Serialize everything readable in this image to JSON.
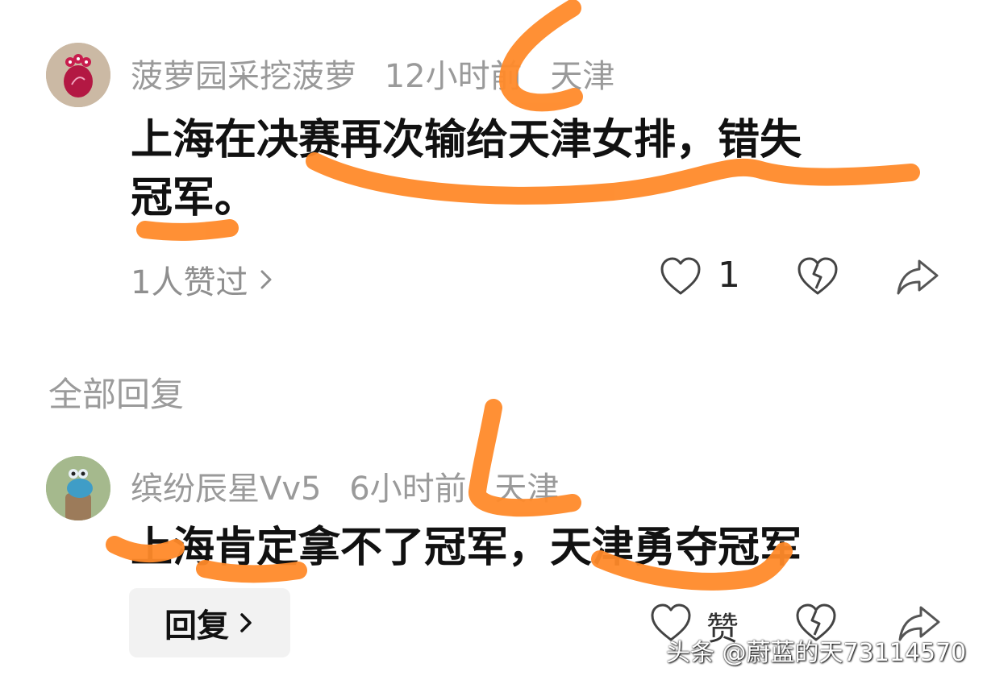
{
  "comment": {
    "author": "菠萝园采挖菠萝",
    "time": "12小时前",
    "location": "天津",
    "text_line1": "上海在决赛再次输给天津女排，错失",
    "text_line2": "冠军。",
    "likes_link": "1人赞过",
    "like_count": "1"
  },
  "section_title": "全部回复",
  "reply": {
    "author": "缤纷辰星Vv5",
    "time": "6小时前",
    "location": "天津",
    "text": "上海肯定拿不了冠军，天津勇夺冠军",
    "reply_button": "回复",
    "like_label": "赞"
  },
  "watermark": "头条 @蔚蓝的天73114570",
  "colors": {
    "highlight": "#ff8a2a",
    "meta_gray": "#9a9a9a",
    "text_black": "#111111"
  },
  "icons": [
    "chevron-right-icon",
    "heart-icon",
    "broken-heart-icon",
    "share-icon"
  ]
}
